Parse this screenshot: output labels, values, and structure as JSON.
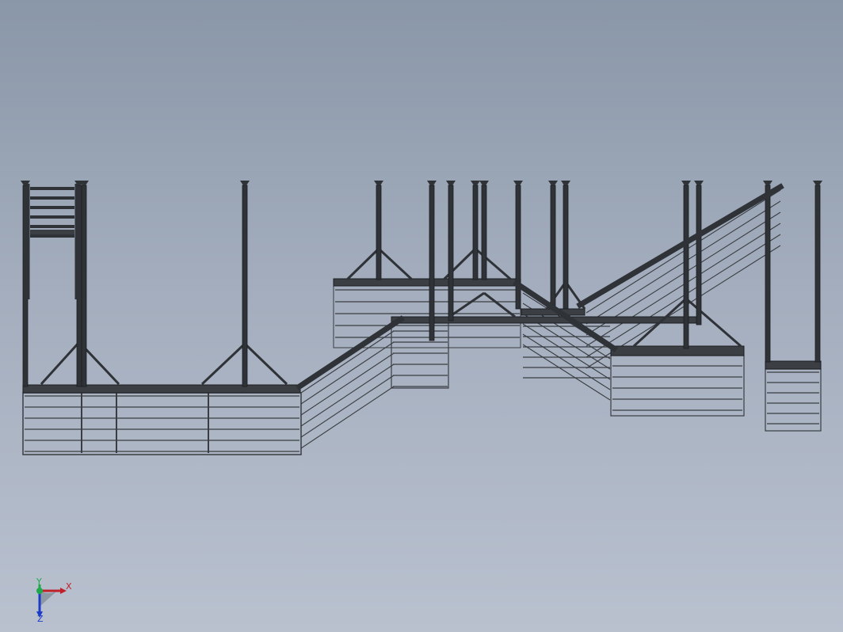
{
  "colors": {
    "background_top": "#8a97a8",
    "background_bottom": "#b9c1cf",
    "steel": "#2f3236",
    "steel_edge": "#1c1e21",
    "deck": "#3b3e43",
    "rail": "#3a3d42",
    "axis_x": "#c0202a",
    "axis_y": "#1fa84a",
    "axis_z": "#1c3cc8"
  },
  "triad": {
    "x_label": "X",
    "y_label": "Y",
    "z_label": "Z"
  },
  "model": {
    "type": "steel structure with stairs, platforms and cable railings",
    "view": "front"
  }
}
